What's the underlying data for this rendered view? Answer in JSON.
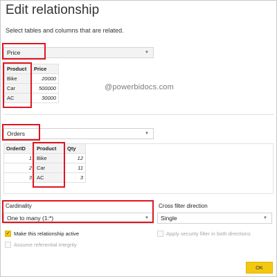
{
  "dialog": {
    "title": "Edit relationship",
    "subtitle": "Select tables and columns that are related."
  },
  "watermark": "@powerbidocs.com",
  "table1": {
    "selected": "Price",
    "columns": [
      "Product",
      "Price"
    ],
    "rows": [
      [
        "Bike",
        "20000"
      ],
      [
        "Car",
        "500000"
      ],
      [
        "AC",
        "30000"
      ]
    ]
  },
  "table2": {
    "selected": "Orders",
    "columns": [
      "OrderID",
      "Product",
      "Qty"
    ],
    "rows": [
      [
        "1",
        "Bike",
        "12"
      ],
      [
        "2",
        "Car",
        "11"
      ],
      [
        "3",
        "AC",
        "3"
      ]
    ]
  },
  "cardinality": {
    "label": "Cardinality",
    "value": "One to many (1:*)"
  },
  "cross_filter": {
    "label": "Cross filter direction",
    "value": "Single"
  },
  "options": {
    "make_active": {
      "label": "Make this relationship active",
      "checked": true
    },
    "assume_integrity": {
      "label": "Assume referential integrity",
      "checked": false
    },
    "security_filter": {
      "label": "Apply security filter in both directions",
      "checked": false
    }
  },
  "buttons": {
    "ok": "OK"
  },
  "colors": {
    "highlight": "#e0141e",
    "accent": "#f2c811",
    "header_bg": "#f3f3f3"
  }
}
